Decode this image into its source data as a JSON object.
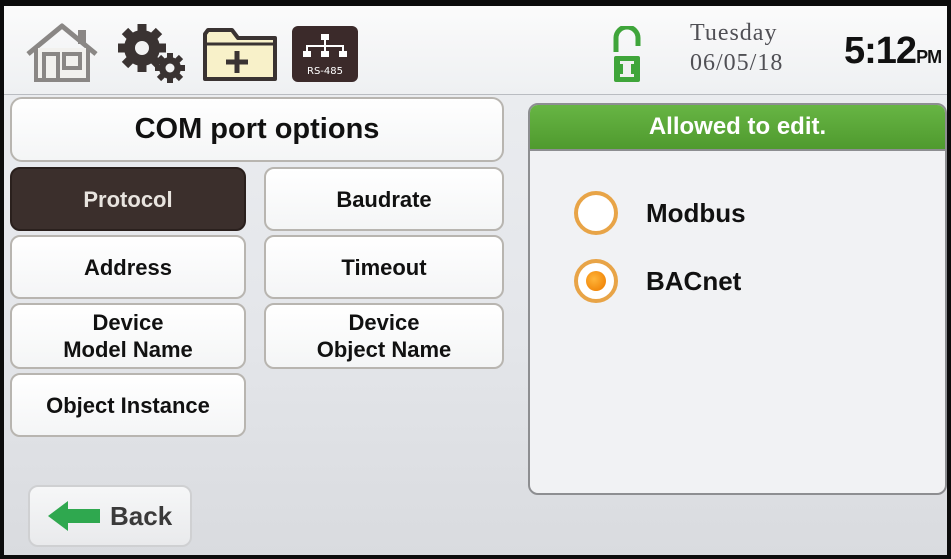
{
  "topbar": {
    "icons": [
      "home-icon",
      "gear-icon",
      "folder-add-icon",
      "rs485-network-icon",
      "unlock-icon"
    ],
    "rs485_label": "RS-485",
    "lock_label": "I",
    "day": "Tuesday",
    "date": "06/05/18",
    "time": "5:12",
    "ampm": "PM"
  },
  "left": {
    "title": "COM port options",
    "buttons": {
      "protocol": "Protocol",
      "baudrate": "Baudrate",
      "address": "Address",
      "timeout": "Timeout",
      "device_model_line1": "Device",
      "device_model_line2": "Model Name",
      "device_object_line1": "Device",
      "device_object_line2": "Object Name",
      "object_instance": "Object Instance"
    },
    "selected": "Protocol",
    "back_label": "Back"
  },
  "edit_panel": {
    "header": "Allowed to edit.",
    "options": [
      {
        "label": "Modbus",
        "selected": false
      },
      {
        "label": "BACnet",
        "selected": true
      }
    ]
  },
  "colors": {
    "header_green": "#5aa838",
    "selected_button": "#3b2f2c",
    "radio_orange": "#f28a0d",
    "back_arrow_green": "#2fa84f"
  }
}
